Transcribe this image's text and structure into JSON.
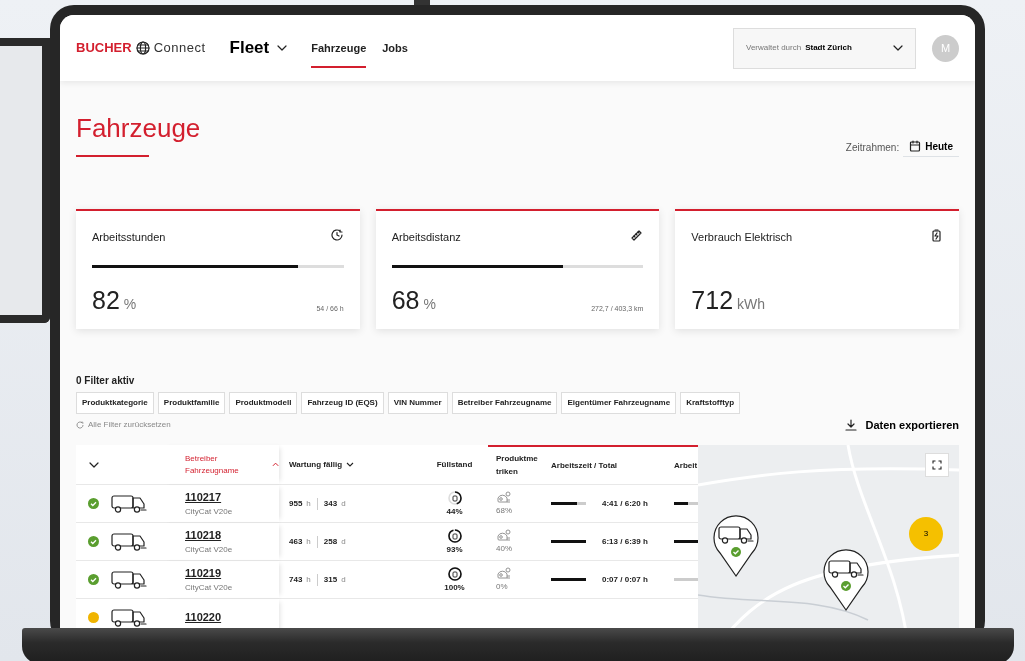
{
  "header": {
    "brand": "BUCHER",
    "product": "Connect",
    "app": "Fleet",
    "tabs": [
      {
        "label": "Fahrzeuge",
        "selected": true
      },
      {
        "label": "Jobs",
        "selected": false
      }
    ],
    "managed_by": {
      "label": "Verwaltet durch",
      "value": "Stadt Zürich"
    },
    "avatar": "M"
  },
  "page": {
    "title": "Fahrzeuge",
    "timeframe": {
      "label": "Zeitrahmen:",
      "value": "Heute"
    }
  },
  "kpis": [
    {
      "title": "Arbeitsstunden",
      "level": 0.82,
      "value": "82",
      "unit": "%",
      "detail": "54 / 66 h"
    },
    {
      "title": "Arbeitsdistanz",
      "level": 0.68,
      "value": "68",
      "unit": "%",
      "detail": "272,7 / 403,3 km"
    },
    {
      "title": "Verbrauch Elektrisch",
      "value": "712",
      "unit": "kWh"
    }
  ],
  "filters": {
    "count_label": "0 Filter aktiv",
    "chips": [
      "Produktkategorie",
      "Produktfamilie",
      "Produktmodell",
      "Fahrzeug ID (EQS)",
      "VIN Nummer",
      "Betreiber Fahrzeugname",
      "Eigentümer Fahrzeugname",
      "Kraftstofftyp"
    ],
    "reset": "Alle Filter zurücksetzen",
    "export": "Daten exportieren"
  },
  "table": {
    "columns": [
      {
        "label": "Betreiber Fahrzeugname",
        "kind": "sorted",
        "active": true,
        "highlighted": false
      },
      {
        "label": "Wartung fällig",
        "kind": "menu",
        "active": false,
        "highlighted": false
      },
      {
        "label": "Füllstand",
        "active": false,
        "highlighted": false
      },
      {
        "label": "Produktmetriken",
        "active": false,
        "highlighted": true
      },
      {
        "label": "Arbeitszeit / Total",
        "active": false,
        "highlighted": true
      },
      {
        "label": "Arbeit",
        "active": false,
        "highlighted": true
      }
    ],
    "rows": [
      {
        "color": "#5a9e2f",
        "name": "110217",
        "model": "CityCat V20e",
        "service_hours": "955",
        "hours_unit": "h",
        "service_days": "343",
        "days_unit": "d",
        "fill": "44%",
        "metrics": "68%",
        "worktime": {
          "level": 0.75,
          "text": "4:41 / 6:20 h"
        },
        "work_next": {
          "level": 0.6
        }
      },
      {
        "color": "#5a9e2f",
        "name": "110218",
        "model": "CityCat V20e",
        "service_hours": "463",
        "hours_unit": "h",
        "service_days": "258",
        "days_unit": "d",
        "fill": "93%",
        "metrics": "40%",
        "worktime": {
          "level": 1,
          "text": "6:13 / 6:39 h"
        },
        "work_next": {
          "level": 1
        }
      },
      {
        "color": "#5a9e2f",
        "name": "110219",
        "model": "CityCat V20e",
        "service_hours": "743",
        "hours_unit": "h",
        "service_days": "315",
        "days_unit": "d",
        "fill": "100%",
        "metrics": "0%",
        "worktime": {
          "level": 1,
          "text": "0:07 / 0:07 h"
        },
        "work_next": {
          "level": 0
        }
      },
      {
        "color": "#f0b400",
        "name": "110220"
      }
    ]
  },
  "map": {
    "markers": [
      {
        "color": "#5a9e2f"
      },
      {
        "color": "#5a9e2f"
      }
    ],
    "cluster": "3"
  }
}
